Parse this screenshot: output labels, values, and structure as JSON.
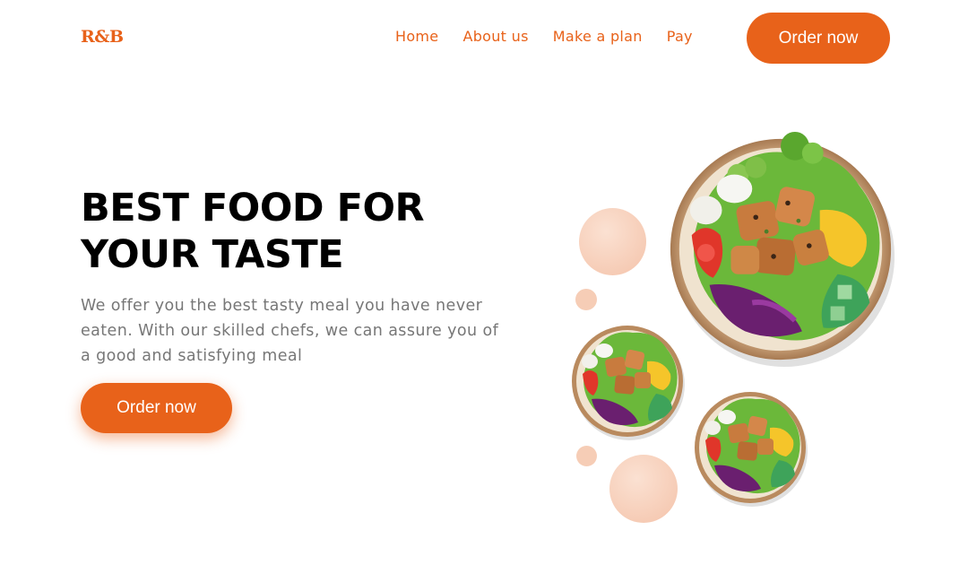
{
  "header": {
    "logo": "R&B",
    "nav": [
      "Home",
      "About us",
      "Make a plan",
      "Pay"
    ],
    "cta_label": "Order now"
  },
  "hero": {
    "title_line1": "BEST FOOD FOR",
    "title_line2": "YOUR TASTE",
    "subtitle": "We offer you the best tasty meal you have never eaten. With our skilled chefs, we can assure you of a good and satisfying meal",
    "cta_label": "Order now"
  },
  "colors": {
    "accent": "#e8621a",
    "title": "#000000",
    "subtitle": "#777777",
    "decor": "#f6cdb6"
  },
  "images": [
    "salad-bowl-large",
    "salad-bowl-small",
    "salad-bowl-small"
  ]
}
